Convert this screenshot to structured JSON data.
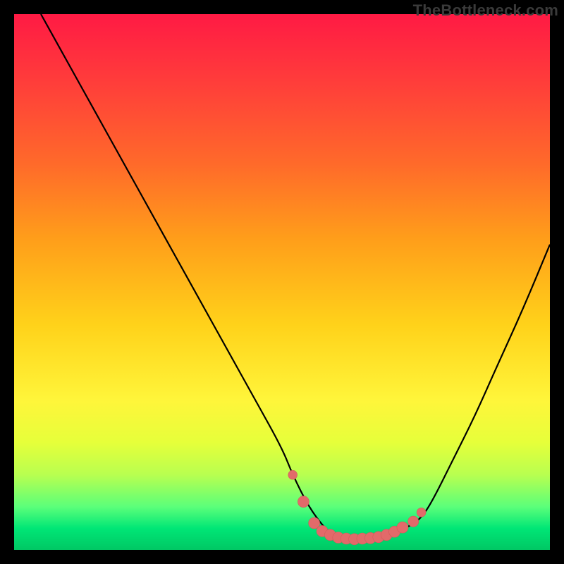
{
  "watermark": {
    "text": "TheBottleneck.com"
  },
  "colors": {
    "curve_stroke": "#000000",
    "marker_fill": "#e26a6a",
    "marker_stroke": "#d25a5a",
    "gradient_top": "#ff1a44",
    "gradient_bottom": "#00c864"
  },
  "chart_data": {
    "type": "line",
    "title": "",
    "xlabel": "",
    "ylabel": "",
    "xlim": [
      0,
      100
    ],
    "ylim": [
      0,
      100
    ],
    "grid": false,
    "legend_position": "none",
    "series": [
      {
        "name": "curve",
        "x": [
          5,
          10,
          15,
          20,
          25,
          30,
          35,
          40,
          45,
          50,
          52,
          55,
          58,
          60,
          63,
          66,
          68,
          70,
          72,
          74,
          76,
          78,
          82,
          86,
          90,
          95,
          100
        ],
        "values": [
          100,
          91,
          82,
          73,
          64,
          55,
          46,
          37,
          28,
          19,
          14,
          8,
          4,
          2.5,
          2,
          2,
          2.3,
          3,
          3.8,
          4.5,
          6,
          9,
          17,
          25,
          34,
          45,
          57
        ]
      }
    ],
    "markers": [
      {
        "x": 52,
        "y": 14,
        "r": 3.2
      },
      {
        "x": 54,
        "y": 9,
        "r": 4.0
      },
      {
        "x": 56,
        "y": 5,
        "r": 4.0
      },
      {
        "x": 57.5,
        "y": 3.5,
        "r": 4.0
      },
      {
        "x": 59,
        "y": 2.8,
        "r": 4.0
      },
      {
        "x": 60.5,
        "y": 2.3,
        "r": 4.0
      },
      {
        "x": 62,
        "y": 2.1,
        "r": 4.0
      },
      {
        "x": 63.5,
        "y": 2.0,
        "r": 4.0
      },
      {
        "x": 65,
        "y": 2.1,
        "r": 4.0
      },
      {
        "x": 66.5,
        "y": 2.2,
        "r": 4.0
      },
      {
        "x": 68,
        "y": 2.4,
        "r": 4.0
      },
      {
        "x": 69.5,
        "y": 2.8,
        "r": 4.0
      },
      {
        "x": 71,
        "y": 3.4,
        "r": 4.0
      },
      {
        "x": 72.5,
        "y": 4.2,
        "r": 4.0
      },
      {
        "x": 74.5,
        "y": 5.3,
        "r": 3.8
      },
      {
        "x": 76,
        "y": 7,
        "r": 3.2
      }
    ]
  }
}
